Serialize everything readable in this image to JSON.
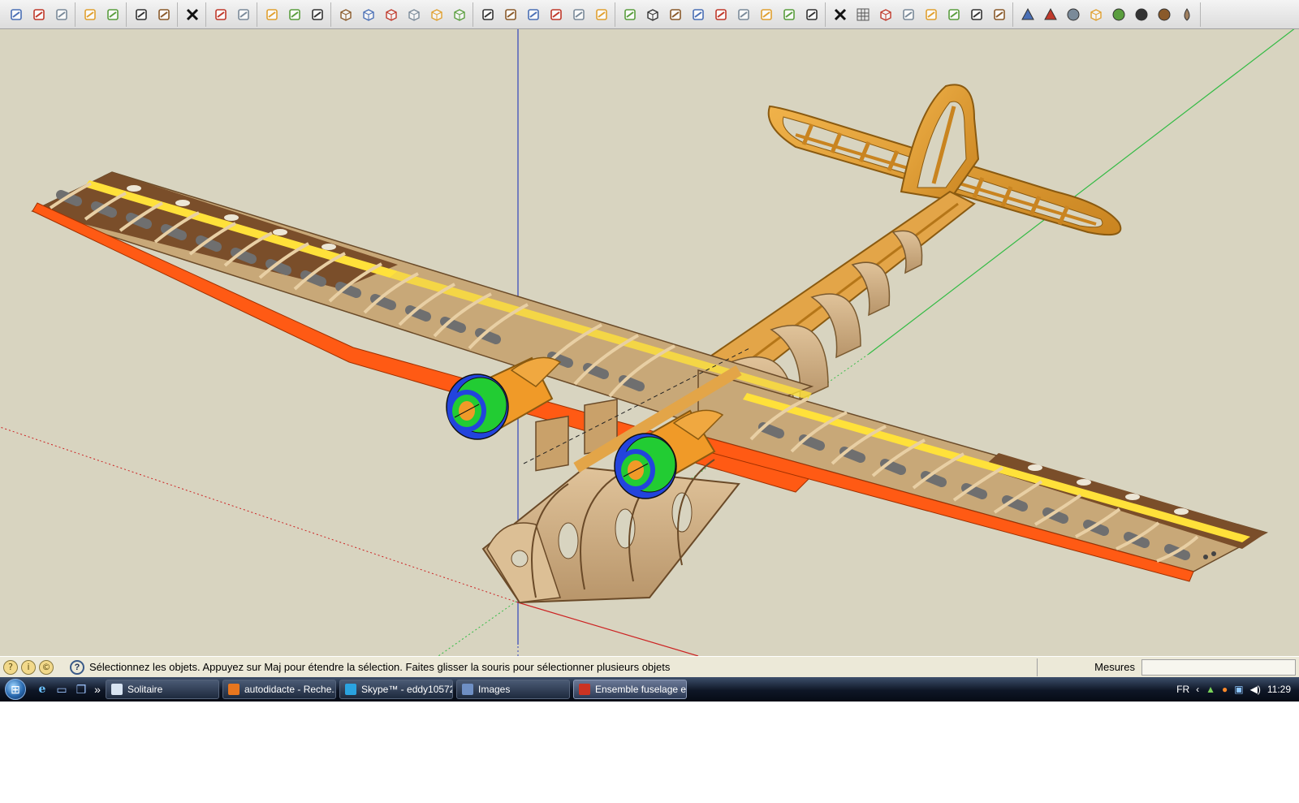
{
  "toolbar": {
    "groups": [
      [
        "new-file-icon",
        "open-folder-icon",
        "save-icon"
      ],
      [
        "make-component-icon",
        "paint-bucket-icon"
      ],
      [
        "cut-icon",
        "paste-icon"
      ],
      [
        "erase-icon"
      ],
      [
        "undo-icon",
        "redo-icon"
      ],
      [
        "print-icon",
        "model-info-icon",
        "select-icon"
      ],
      [
        "iso-view-icon",
        "top-view-icon",
        "front-view-icon",
        "right-view-icon",
        "back-view-icon",
        "left-view-icon"
      ],
      [
        "xray-icon",
        "wireframe-icon",
        "hidden-line-icon",
        "shaded-icon",
        "textured-icon",
        "monochrome-icon"
      ],
      [
        "rectangle-tool-icon",
        "box-tool-icon",
        "push-pull-icon",
        "follow-me-icon",
        "offset-icon",
        "section-plane-icon",
        "tape-measure-icon",
        "protractor-icon",
        "axes-icon"
      ],
      [
        "close-x-icon",
        "grid-icon",
        "sandbox-icon",
        "drape-icon",
        "smoove-icon",
        "stamp-icon",
        "flip-edge-icon",
        "add-detail-icon"
      ],
      [
        "pyramid-icon",
        "cone-icon",
        "sphere-icon",
        "cube-icon",
        "torus-icon",
        "dome-icon",
        "half-sphere-icon",
        "drop-icon"
      ]
    ]
  },
  "statusbar": {
    "message": "Sélectionnez les objets. Appuyez sur Maj pour étendre la sélection. Faites glisser la souris pour sélectionner plusieurs objets",
    "measures_label": "Mesures",
    "measures_value": ""
  },
  "taskbar": {
    "quick_launch": [
      "ie-icon",
      "desktop-icon",
      "switch-windows-icon"
    ],
    "tasks": [
      {
        "label": "Solitaire",
        "icon_color": "#d8e4f2",
        "active": false
      },
      {
        "label": "autodidacte - Reche...",
        "icon_color": "#e8761e",
        "active": false
      },
      {
        "label": "Skype™ - eddy10572",
        "icon_color": "#2aa3e0",
        "active": false
      },
      {
        "label": "Images",
        "icon_color": "#6e8fc4",
        "active": false
      },
      {
        "label": "Ensemble fuselage e...",
        "icon_color": "#cc3322",
        "active": true
      }
    ],
    "tray": {
      "language": "FR",
      "clock": "11:29"
    }
  },
  "colors": {
    "viewport_bg": "#d8d4c0",
    "plywood": "#d9b589",
    "balsa_orange": "#e8a040",
    "leading_edge": "#ff5a14",
    "spar_yellow": "#ffe13a",
    "tip_brown": "#7a4e2a",
    "motor_green": "#22cc33",
    "motor_blue": "#2244dd"
  }
}
